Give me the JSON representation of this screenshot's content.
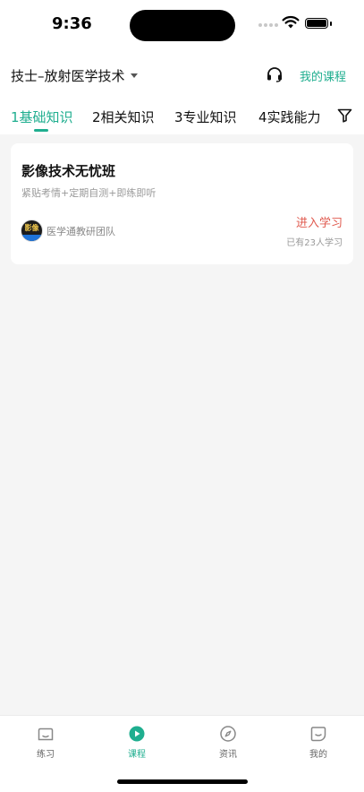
{
  "status_bar": {
    "time": "9:36"
  },
  "header": {
    "subject": "技士–放射医学技术",
    "my_course": "我的课程"
  },
  "tabs": [
    {
      "label": "1基础知识",
      "active": true
    },
    {
      "label": "2相关知识"
    },
    {
      "label": "3专业知识"
    },
    {
      "label": "4实践能力"
    }
  ],
  "course": {
    "title": "影像技术无忧班",
    "subtitle": "紧贴考情+定期自测+即练即听",
    "logo_text": "影像",
    "team": "医学通教研团队",
    "enter_label": "进入学习",
    "learners": "已有23人学习"
  },
  "tabbar": {
    "items": [
      {
        "label": "练习",
        "icon": "practice-icon"
      },
      {
        "label": "课程",
        "icon": "play-icon",
        "active": true
      },
      {
        "label": "资讯",
        "icon": "compass-icon"
      },
      {
        "label": "我的",
        "icon": "profile-icon"
      }
    ]
  },
  "colors": {
    "accent": "#1fae8f",
    "enter": "#e05a4f",
    "background": "#f5f5f5"
  }
}
